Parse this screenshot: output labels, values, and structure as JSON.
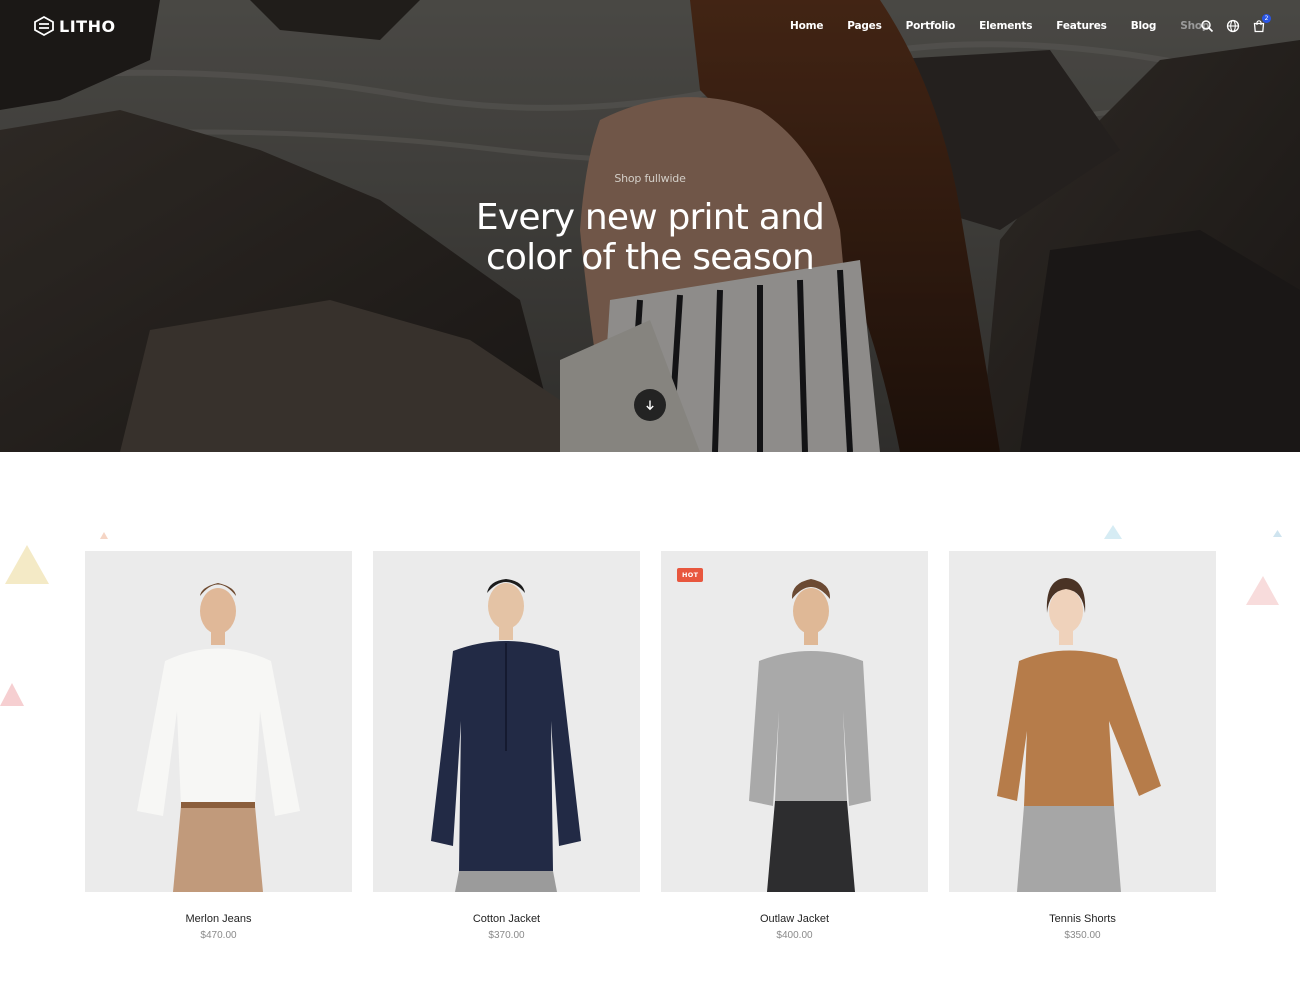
{
  "brand": {
    "name": "LITHO"
  },
  "nav": {
    "items": [
      {
        "label": "Home",
        "active": false
      },
      {
        "label": "Pages",
        "active": false
      },
      {
        "label": "Portfolio",
        "active": false
      },
      {
        "label": "Elements",
        "active": false
      },
      {
        "label": "Features",
        "active": false
      },
      {
        "label": "Blog",
        "active": false
      },
      {
        "label": "Shop",
        "active": true
      }
    ],
    "icons": [
      "search-icon",
      "globe-icon",
      "cart-icon"
    ],
    "cart_count": "2"
  },
  "hero": {
    "subtitle": "Shop fullwide",
    "title_line1": "Every new print and",
    "title_line2": "color of the season",
    "scroll_icon": "arrow-down-icon"
  },
  "products": [
    {
      "name": "Merlon Jeans",
      "price": "$470.00",
      "badge": "",
      "top_color": "#f7f7f5",
      "bottom_color": "#c19a7b"
    },
    {
      "name": "Cotton Jacket",
      "price": "$370.00",
      "badge": "",
      "top_color": "#222a45",
      "bottom_color": "#9b9b9b"
    },
    {
      "name": "Outlaw Jacket",
      "price": "$400.00",
      "badge": "HOT",
      "top_color": "#a9a9a9",
      "bottom_color": "#2d2d2f"
    },
    {
      "name": "Tennis Shorts",
      "price": "$350.00",
      "badge": "",
      "top_color": "#b67c4a",
      "bottom_color": "#a6a6a6"
    }
  ],
  "colors": {
    "badge_hot": "#e8573e",
    "cart_badge": "#2a55e5",
    "price": "#8a8a8a"
  }
}
